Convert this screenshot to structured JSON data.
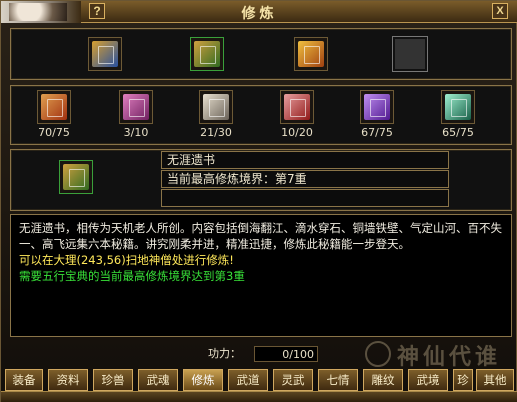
{
  "window": {
    "title": "修炼",
    "help_label": "?",
    "close_label": "X"
  },
  "top_books": [
    {
      "icon": "blue-gold-book-icon",
      "color": "#c84a1a"
    },
    {
      "icon": "green-scroll-book-icon",
      "color": "#3a7a2a"
    },
    {
      "icon": "gold-chest-book-icon",
      "color": "#c88a1a"
    },
    {
      "icon": "empty-slot",
      "color": "#333333"
    }
  ],
  "skill_books": [
    {
      "icon": "orange-scroll-icon",
      "count": "70/75",
      "color": "#c05a18"
    },
    {
      "icon": "purple-scroll-icon",
      "count": "3/10",
      "color": "#a8308a"
    },
    {
      "icon": "white-scroll-icon",
      "count": "21/30",
      "color": "#8a8478"
    },
    {
      "icon": "red-scroll-icon",
      "count": "10/20",
      "color": "#b82020"
    },
    {
      "icon": "violet-scroll-icon",
      "count": "67/75",
      "color": "#7a30c0"
    },
    {
      "icon": "teal-scroll-icon",
      "count": "65/75",
      "color": "#2a9070"
    }
  ],
  "selected": {
    "icon": "green-scroll-book-icon",
    "name": "无涯遗书",
    "realm_text": "当前最高修炼境界：第7重"
  },
  "description": {
    "line1": "无涯遗书，相传为天机老人所创。内容包括倒海翻江、滴水穿石、铜墙铁壁、气定山河、百不失一、高飞远集六本秘籍。讲究刚柔并进，精准迅捷，修炼此秘籍能一步登天。",
    "location": "可以在大理(243,56)扫地神僧处进行修炼!",
    "requirement": "需要五行宝典的当前最高修炼境界达到第3重"
  },
  "power": {
    "label": "功力：",
    "value": "0/100"
  },
  "tabs": [
    "装备",
    "资料",
    "珍兽",
    "武魂",
    "修炼",
    "武道",
    "灵武",
    "七情",
    "雕纹",
    "武境",
    "珍藏",
    "其他"
  ],
  "active_tab": "修炼",
  "watermark": "神仙代谁"
}
